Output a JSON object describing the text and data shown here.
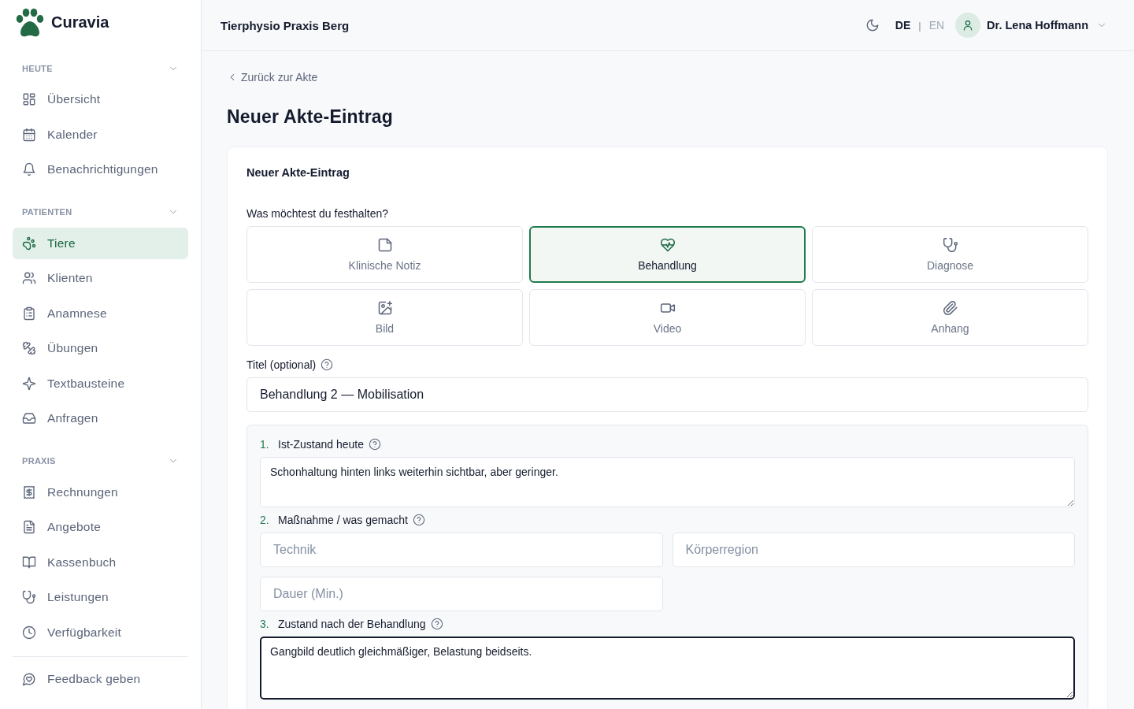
{
  "brand": {
    "name": "Curavia"
  },
  "sidebar": {
    "groups": [
      {
        "title": "HEUTE",
        "expanded": true,
        "items": [
          {
            "label": "Übersicht",
            "selected": false
          },
          {
            "label": "Kalender",
            "selected": false
          },
          {
            "label": "Benachrichtigungen",
            "selected": false
          }
        ]
      },
      {
        "title": "PATIENTEN",
        "expanded": true,
        "items": [
          {
            "label": "Tiere",
            "selected": true
          },
          {
            "label": "Klienten",
            "selected": false
          },
          {
            "label": "Anamnese",
            "selected": false
          },
          {
            "label": "Übungen",
            "selected": false
          },
          {
            "label": "Textbausteine",
            "selected": false
          },
          {
            "label": "Anfragen",
            "selected": false
          }
        ]
      },
      {
        "title": "PRAXIS",
        "expanded": true,
        "items": [
          {
            "label": "Rechnungen",
            "selected": false
          },
          {
            "label": "Angebote",
            "selected": false
          },
          {
            "label": "Kassenbuch",
            "selected": false
          },
          {
            "label": "Leistungen",
            "selected": false
          },
          {
            "label": "Verfügbarkeit",
            "selected": false
          }
        ]
      }
    ],
    "footer_items": [
      {
        "label": "Feedback geben",
        "selected": false
      }
    ]
  },
  "header": {
    "practice": "Tierphysio Praxis Berg",
    "languages": [
      {
        "label": "DE",
        "selected": true
      },
      {
        "label": "EN",
        "selected": false
      }
    ],
    "separator": "|",
    "dark_mode": false,
    "user": "Dr. Lena Hoffmann"
  },
  "page": {
    "back_link": "Zurück zur Akte",
    "title": "Neuer Akte-Eintrag"
  },
  "card": {
    "title": "Neuer Akte-Eintrag",
    "type_question": "Was möchtest du festhalten?",
    "types": [
      {
        "label": "Klinische Notiz",
        "selected": false
      },
      {
        "label": "Behandlung",
        "selected": true
      },
      {
        "label": "Diagnose",
        "selected": false
      },
      {
        "label": "Bild",
        "selected": false
      },
      {
        "label": "Video",
        "selected": false
      },
      {
        "label": "Anhang",
        "selected": false
      }
    ],
    "title_field": {
      "label": "Titel (optional)",
      "value": "Behandlung 2 — Mobilisation"
    },
    "sections": [
      {
        "number": "1.",
        "label": "Ist-Zustand heute",
        "kind": "textarea",
        "value": "Schonhaltung hinten links weiterhin sichtbar, aber geringer.",
        "focused": false
      },
      {
        "number": "2.",
        "label": "Maßnahme / was gemacht",
        "kind": "fields",
        "fields": [
          {
            "placeholder": "Technik"
          },
          {
            "placeholder": "Körperregion"
          },
          {
            "placeholder": "Dauer (Min.)"
          }
        ]
      },
      {
        "number": "3.",
        "label": "Zustand nach der Behandlung",
        "kind": "textarea",
        "value": "Gangbild deutlich gleichmäßiger, Belastung beidseits.",
        "focused": true
      }
    ]
  }
}
